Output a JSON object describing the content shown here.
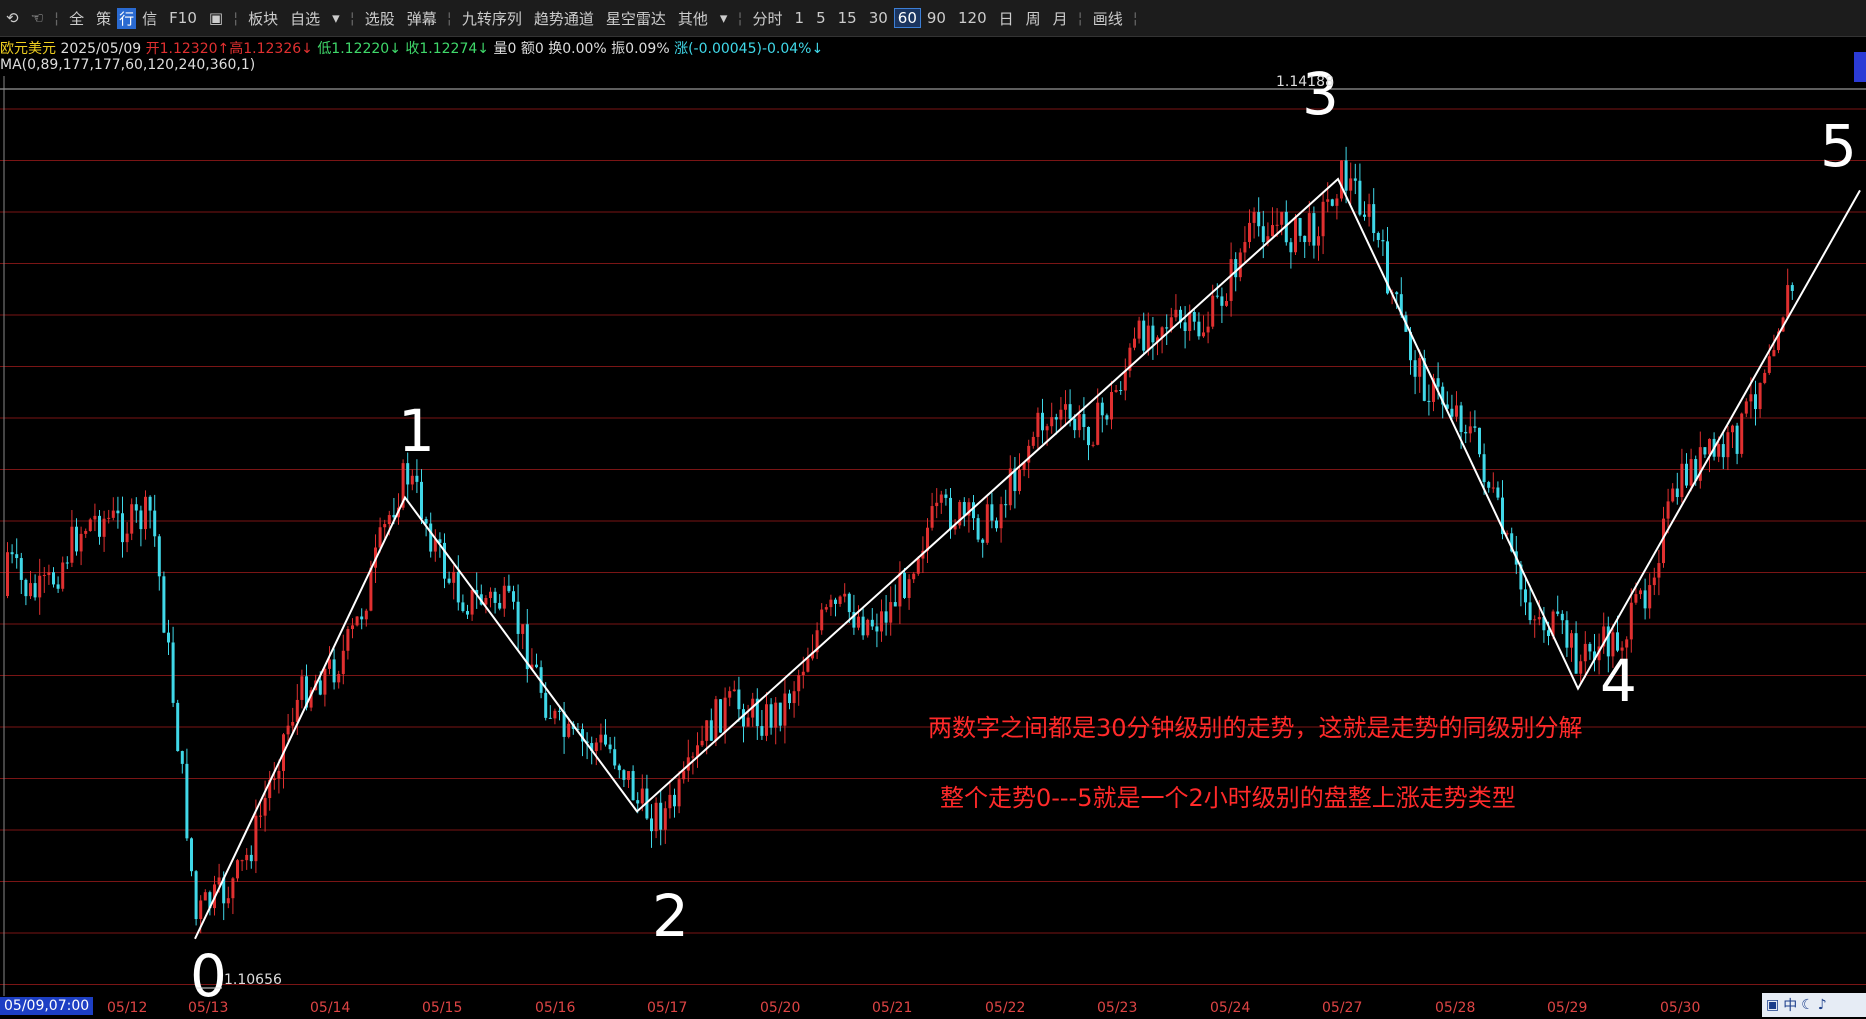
{
  "toolbar": {
    "items": [
      "全",
      "策",
      "行",
      "信",
      "F10",
      "板块",
      "自选",
      "选股",
      "弹幕",
      "九转序列",
      "趋势通道",
      "星空雷达",
      "其他",
      "分时",
      "1",
      "5",
      "15",
      "30",
      "60",
      "90",
      "120",
      "日",
      "周",
      "月",
      "画线"
    ],
    "selected": "60"
  },
  "info": {
    "symbol": "欧元美元",
    "date": "2025/05/09",
    "open": "开1.12320↑",
    "high": "高1.12326↓",
    "low": "低1.12220↓",
    "close": "收1.12274↓",
    "volume": "量0",
    "amount": "额0",
    "turnover": "换0.00%",
    "amplitude": "振0.09%",
    "change": "涨(-0.00045)-0.04%↓"
  },
  "ma": "MA(0,89,177,177,60,120,240,360,1)",
  "annotations": {
    "high_price": "1.14188",
    "low_price": "1.10656",
    "wave_labels": [
      "0",
      "1",
      "2",
      "3",
      "4",
      "5"
    ],
    "note1": "两数字之间都是30分钟级别的走势，这就是走势的同级别分解",
    "note2": "整个走势0---5就是一个2小时级别的盘整上涨走势类型"
  },
  "dates": {
    "start": "05/09,07:00",
    "labels": [
      "05/12",
      "05/13",
      "05/14",
      "05/15",
      "05/16",
      "05/17",
      "05/20",
      "05/21",
      "05/22",
      "05/23",
      "05/24",
      "05/27",
      "05/28",
      "05/29",
      "05/30"
    ]
  },
  "tray": {
    "items": [
      "中",
      "♪"
    ]
  },
  "chart_data": {
    "type": "candlestick",
    "ylim": [
      1.104,
      1.144
    ],
    "wave_points": [
      {
        "label": "0",
        "date": "05/13",
        "price": 1.1066
      },
      {
        "label": "1",
        "date": "05/14",
        "price": 1.126
      },
      {
        "label": "2",
        "date": "05/16",
        "price": 1.1122
      },
      {
        "label": "3",
        "date": "05/26",
        "price": 1.14
      },
      {
        "label": "4",
        "date": "05/29",
        "price": 1.1176
      },
      {
        "label": "5",
        "date": "05/30",
        "price": 1.1395
      }
    ],
    "colors": {
      "up": "#e03030",
      "down": "#40d8e8",
      "grid": "#7a1515",
      "wave": "#ffffff"
    }
  }
}
